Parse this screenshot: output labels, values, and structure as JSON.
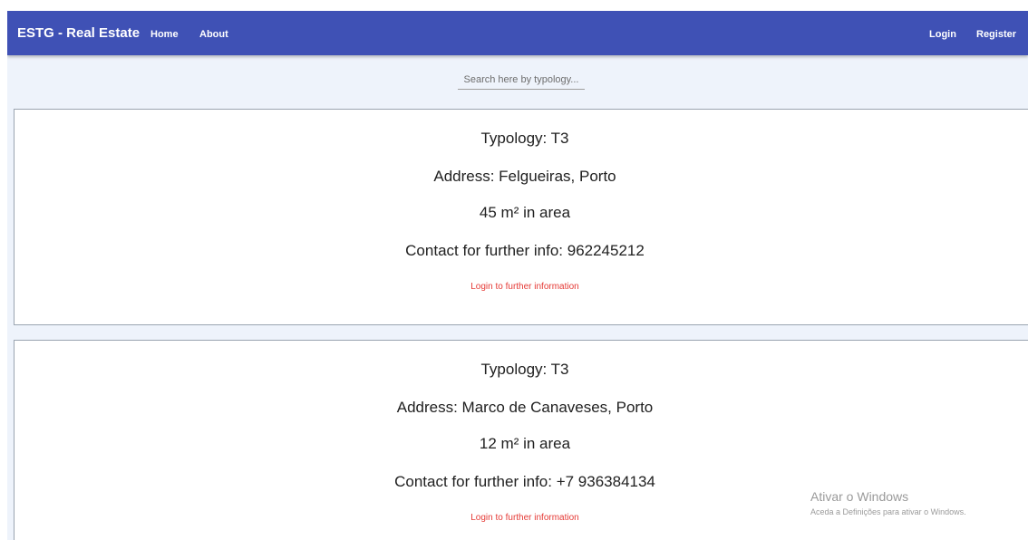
{
  "navbar": {
    "brand": "ESTG - Real Estate",
    "links": [
      {
        "label": "Home"
      },
      {
        "label": "About"
      }
    ],
    "login_label": "Login",
    "register_label": "Register"
  },
  "search": {
    "placeholder": "Search here by typology..."
  },
  "listings": [
    {
      "typology": "Typology: T3",
      "address": "Address: Felgueiras, Porto",
      "area": "45 m² in area",
      "contact": "Contact for further info: 962245212",
      "link_label": "Login to further information"
    },
    {
      "typology": "Typology: T3",
      "address": "Address: Marco de Canaveses, Porto",
      "area": "12 m² in area",
      "contact": "Contact for further info: +7 936384134",
      "link_label": "Login to further information"
    }
  ],
  "watermark": {
    "title": "Ativar o Windows",
    "subtitle": "Aceda a Definições para ativar o Windows."
  }
}
